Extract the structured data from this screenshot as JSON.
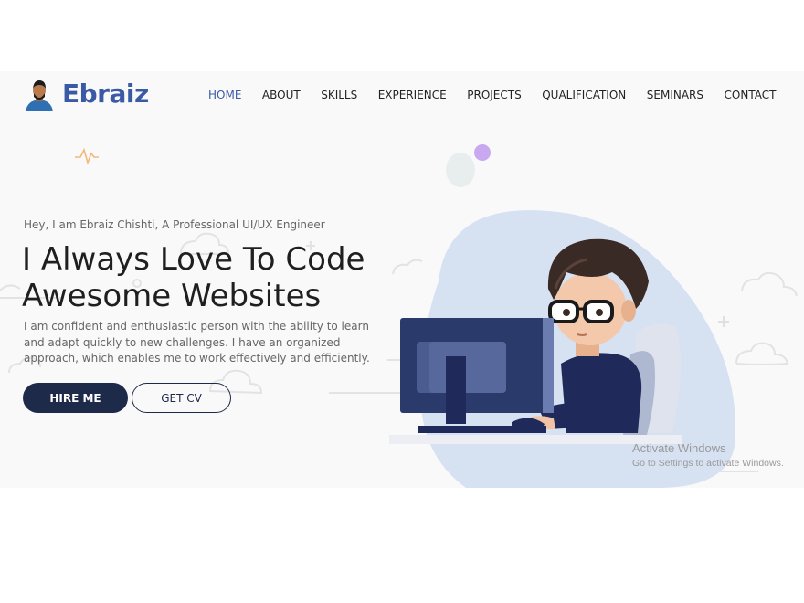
{
  "brand": {
    "name": "Ebraiz"
  },
  "nav": {
    "items": [
      {
        "label": "HOME",
        "active": true
      },
      {
        "label": "ABOUT",
        "active": false
      },
      {
        "label": "SKILLS",
        "active": false
      },
      {
        "label": "EXPERIENCE",
        "active": false
      },
      {
        "label": "PROJECTS",
        "active": false
      },
      {
        "label": "QUALIFICATION",
        "active": false
      },
      {
        "label": "SEMINARS",
        "active": false
      },
      {
        "label": "CONTACT",
        "active": false
      }
    ]
  },
  "hero": {
    "intro": "Hey, I am Ebraiz Chishti, A Professional UI/UX Engineer",
    "headline_line1": "I Always Love To Code",
    "headline_line2": "Awesome Websites",
    "description": "I am confident and enthusiastic person with the ability to learn and adapt quickly to new challenges. I have an organized approach, which enables me to work effectively and efficiently.",
    "hire_button": "HIRE ME",
    "cv_button": "GET CV"
  },
  "watermark": {
    "title": "Activate Windows",
    "subtitle": "Go to Settings to activate Windows."
  },
  "colors": {
    "brand": "#3b5aa6",
    "dark": "#1e2a4a",
    "blob": "#d6e1f2",
    "background": "#f9f9fa"
  }
}
